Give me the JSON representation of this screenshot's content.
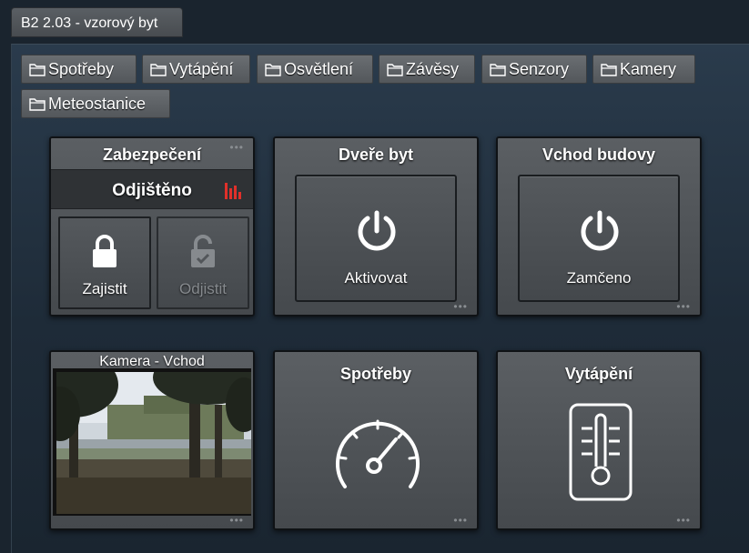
{
  "window": {
    "title": "B2 2.03 - vzorový byt"
  },
  "tabs": [
    {
      "label": "Spotřeby"
    },
    {
      "label": "Vytápění"
    },
    {
      "label": "Osvětlení"
    },
    {
      "label": "Závěsy"
    },
    {
      "label": "Senzory"
    },
    {
      "label": "Kamery"
    },
    {
      "label": "Meteostanice"
    }
  ],
  "security": {
    "title": "Zabezpečení",
    "status": "Odjištěno",
    "lock_label": "Zajistit",
    "unlock_label": "Odjistit"
  },
  "door": {
    "title": "Dveře byt",
    "button_label": "Aktivovat"
  },
  "entrance": {
    "title": "Vchod budovy",
    "button_label": "Zamčeno"
  },
  "camera": {
    "title": "Kamera - Vchod"
  },
  "consumption": {
    "title": "Spotřeby"
  },
  "heating": {
    "title": "Vytápění"
  },
  "tile_menu": "•••",
  "colors": {
    "accent_red": "#e0302a",
    "text": "#ffffff",
    "disabled_text": "#9a9ea2"
  }
}
